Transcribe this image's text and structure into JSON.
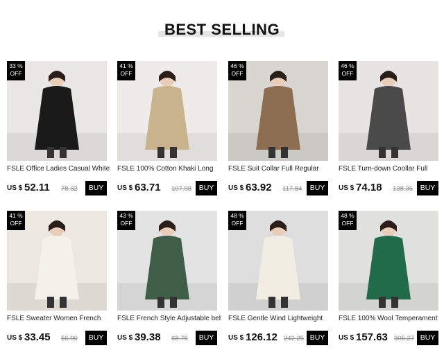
{
  "header": {
    "title": "BEST SELLING"
  },
  "currency_prefix": "US $",
  "buy_label": "BUY",
  "products": [
    {
      "badge_pct": "33 %",
      "badge_off": "OFF",
      "name": "FSLE Office Ladies Casual White",
      "price": "52.11",
      "old_price": "78.32",
      "bg": "#e9e7e5",
      "coat": "#1a1a1a"
    },
    {
      "badge_pct": "41 %",
      "badge_off": "OFF",
      "name": "FSLE 100% Cotton Khaki Long",
      "price": "63.71",
      "old_price": "107.98",
      "bg": "#eeecea",
      "coat": "#c9b38c"
    },
    {
      "badge_pct": "46 %",
      "badge_off": "OFF",
      "name": "FSLE Suit Collar Full Regular",
      "price": "63.92",
      "old_price": "117.84",
      "bg": "#d9d5d1",
      "coat": "#8c6d50"
    },
    {
      "badge_pct": "46 %",
      "badge_off": "OFF",
      "name": "FSLE Turn-down Coollar Full",
      "price": "74.18",
      "old_price": "138.36",
      "bg": "#e6e5e3",
      "coat": "#4a4a4a"
    },
    {
      "badge_pct": "41 %",
      "badge_off": "OFF",
      "name": "FSLE Sweater Women French",
      "price": "33.45",
      "old_price": "56.90",
      "bg": "#ece7e1",
      "coat": "#f4f1ea"
    },
    {
      "badge_pct": "43 %",
      "badge_off": "OFF",
      "name": "FSLE French Style Adjustable belt",
      "price": "39.38",
      "old_price": "68.76",
      "bg": "#e3e3e3",
      "coat": "#3f5e47"
    },
    {
      "badge_pct": "48 %",
      "badge_off": "OFF",
      "name": "FSLE Gentle Wind Lightweight",
      "price": "126.12",
      "old_price": "242.25",
      "bg": "#dedede",
      "coat": "#f1ede2"
    },
    {
      "badge_pct": "48 %",
      "badge_off": "OFF",
      "name": "FSLE 100% Wool Temperament",
      "price": "157.63",
      "old_price": "305.27",
      "bg": "#e0e0df",
      "coat": "#1f6b4a"
    }
  ]
}
